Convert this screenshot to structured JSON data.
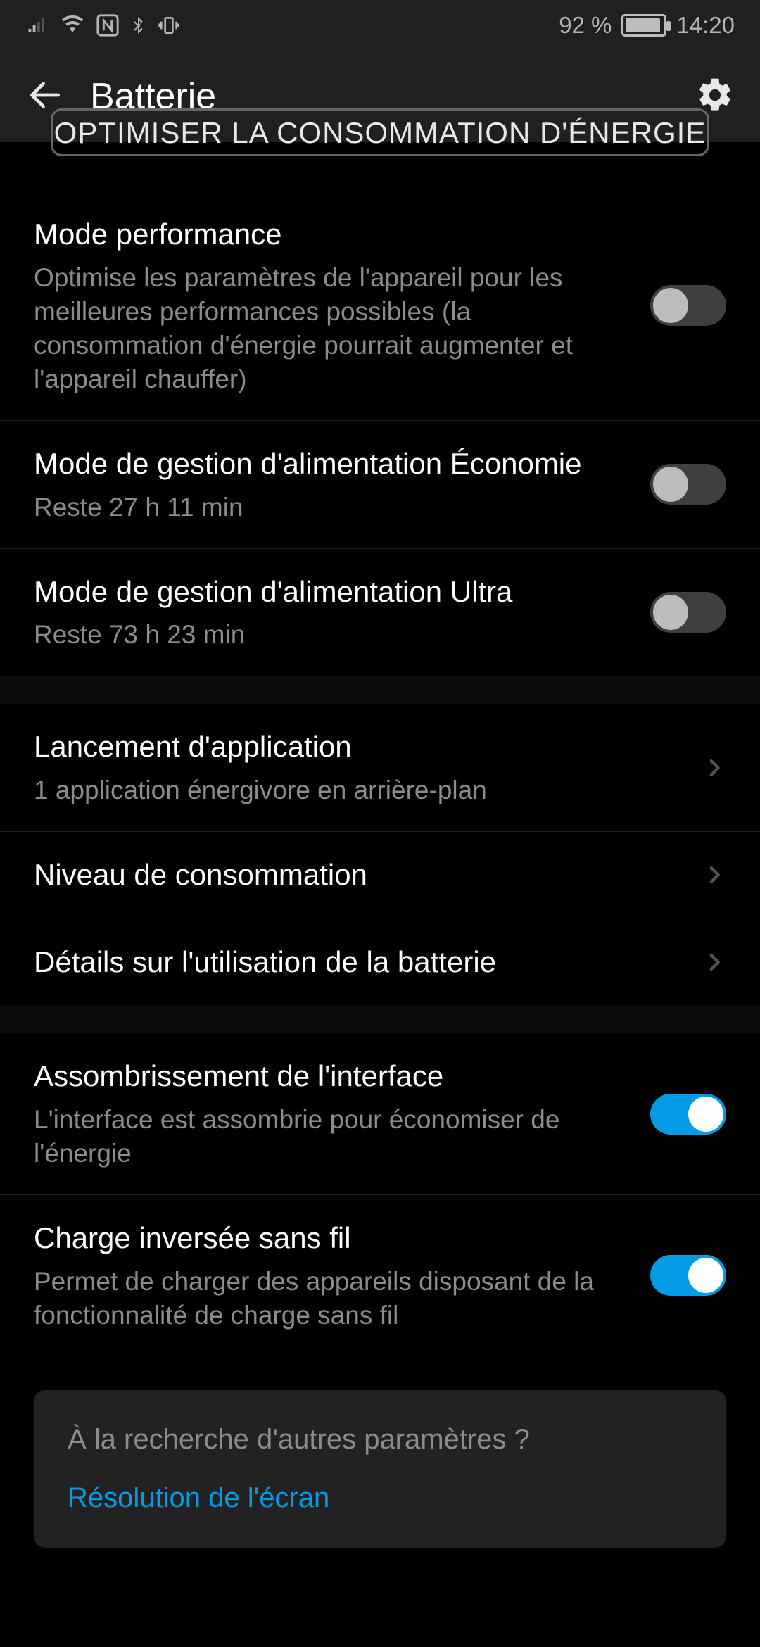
{
  "status": {
    "battery_pct": "92 %",
    "time": "14:20"
  },
  "toolbar": {
    "title": "Batterie"
  },
  "optimize_button": "OPTIMISER LA CONSOMMATION D'ÉNERGIE",
  "section1": {
    "performance": {
      "title": "Mode performance",
      "sub": "Optimise les paramètres de l'appareil pour les meilleures performances possibles (la consommation d'énergie pourrait augmenter et l'appareil chauffer)",
      "on": false
    },
    "economy": {
      "title": "Mode de gestion d'alimentation Économie",
      "sub": "Reste 27 h 11 min",
      "on": false
    },
    "ultra": {
      "title": "Mode de gestion d'alimentation Ultra",
      "sub": "Reste 73 h 23 min",
      "on": false
    }
  },
  "section2": {
    "launch": {
      "title": "Lancement d'application",
      "sub": "1 application énergivore en arrière-plan"
    },
    "level": {
      "title": "Niveau de consommation"
    },
    "details": {
      "title": "Détails sur l'utilisation de la batterie"
    }
  },
  "section3": {
    "darken": {
      "title": "Assombrissement de l'interface",
      "sub": "L'interface est assombrie pour économiser de l'énergie",
      "on": true
    },
    "reverse": {
      "title": "Charge inversée sans fil",
      "sub": "Permet de charger des appareils disposant de la fonctionnalité de charge sans fil",
      "on": true
    }
  },
  "footer": {
    "question": "À la recherche d'autres paramètres ?",
    "link": "Résolution de l'écran"
  }
}
